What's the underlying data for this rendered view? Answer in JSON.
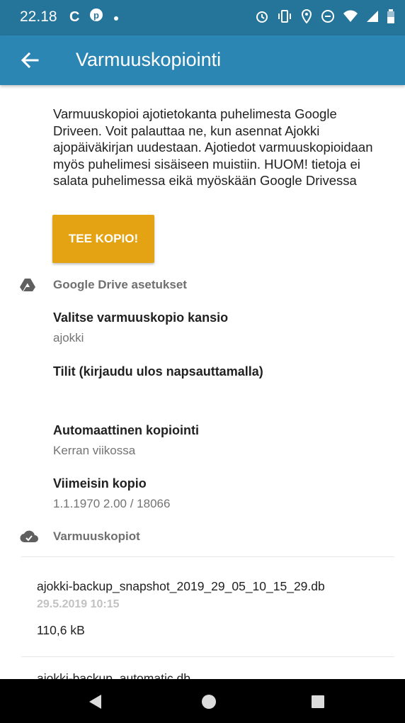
{
  "status_bar": {
    "time": "22.18",
    "left_icons": [
      "c-notification-icon",
      "pinterest-icon",
      "dot-icon"
    ],
    "right_icons": [
      "alarm-icon",
      "vibrate-icon",
      "location-icon",
      "do-not-disturb-icon",
      "wifi-icon",
      "signal-icon",
      "battery-icon"
    ]
  },
  "app_bar": {
    "title": "Varmuuskopiointi"
  },
  "description": "Varmuuskopioi ajotietokanta puhelimesta Google Driveen. Voit palauttaa ne, kun asennat Ajokki ajopäiväkirjan uudestaan. Ajotiedot varmuuskopioidaan myös puhelimesi sisäiseen muistiin. HUOM! tietoja ei salata puhelimessa eikä myöskään Google Drivessa",
  "backup_button": {
    "label": "TEE KOPIO!"
  },
  "google_drive_section": {
    "header": "Google Drive asetukset",
    "folder": {
      "title": "Valitse varmuuskopio kansio",
      "summary": "ajokki"
    },
    "accounts": {
      "title": "Tilit (kirjaudu ulos napsauttamalla)"
    },
    "auto_backup": {
      "title": "Automaattinen kopiointi",
      "summary": "Kerran viikossa"
    },
    "latest": {
      "title": "Viimeisin kopio",
      "summary": "1.1.1970 2.00 / 18066"
    }
  },
  "backups_section": {
    "header": "Varmuuskopiot",
    "items": [
      {
        "filename": "ajokki-backup_snapshot_2019_29_05_10_15_29.db",
        "date": "29.5.2019 10:15",
        "size": "110,6 kB"
      },
      {
        "filename": "ajokki-backup_automatic.db"
      }
    ]
  },
  "colors": {
    "status_bar": "#25749a",
    "app_bar": "#2c86b4",
    "accent_button": "#e4a312",
    "section_header": "#6f6f6f",
    "nav_bar": "#000000"
  }
}
